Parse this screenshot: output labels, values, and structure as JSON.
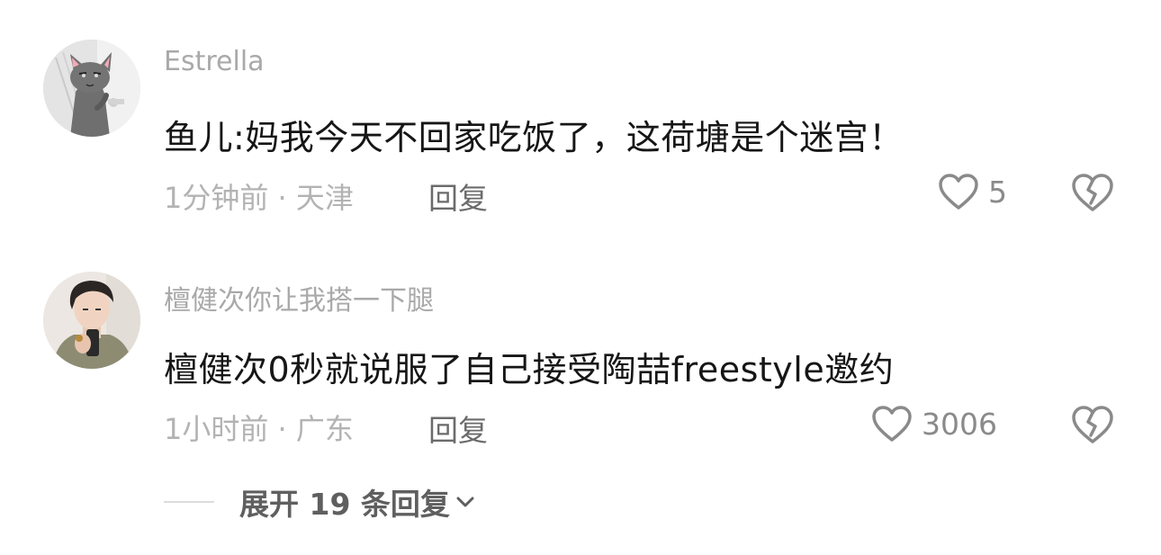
{
  "comments": [
    {
      "username": "Estrella",
      "text": "鱼儿:妈我今天不回家吃饭了，这荷塘是个迷宫！",
      "time": "1分钟前",
      "separator": " · ",
      "location": "天津",
      "reply_label": "回复",
      "likes": "5",
      "avatar_icon": "gray-cat-avatar"
    },
    {
      "username": "檀健次你让我搭一下腿",
      "text": "檀健次0秒就说服了自己接受陶喆freestyle邀约",
      "time": "1小时前",
      "separator": " · ",
      "location": "广东",
      "reply_label": "回复",
      "likes": "3006",
      "avatar_icon": "person-selfie-avatar"
    }
  ],
  "expand_replies": {
    "label": "展开 19 条回复"
  },
  "colors": {
    "username": "#a9a9a9",
    "text": "#161616",
    "meta": "#b3b3b3",
    "reply": "#6b6b6b",
    "icon": "#8a8a8a"
  }
}
